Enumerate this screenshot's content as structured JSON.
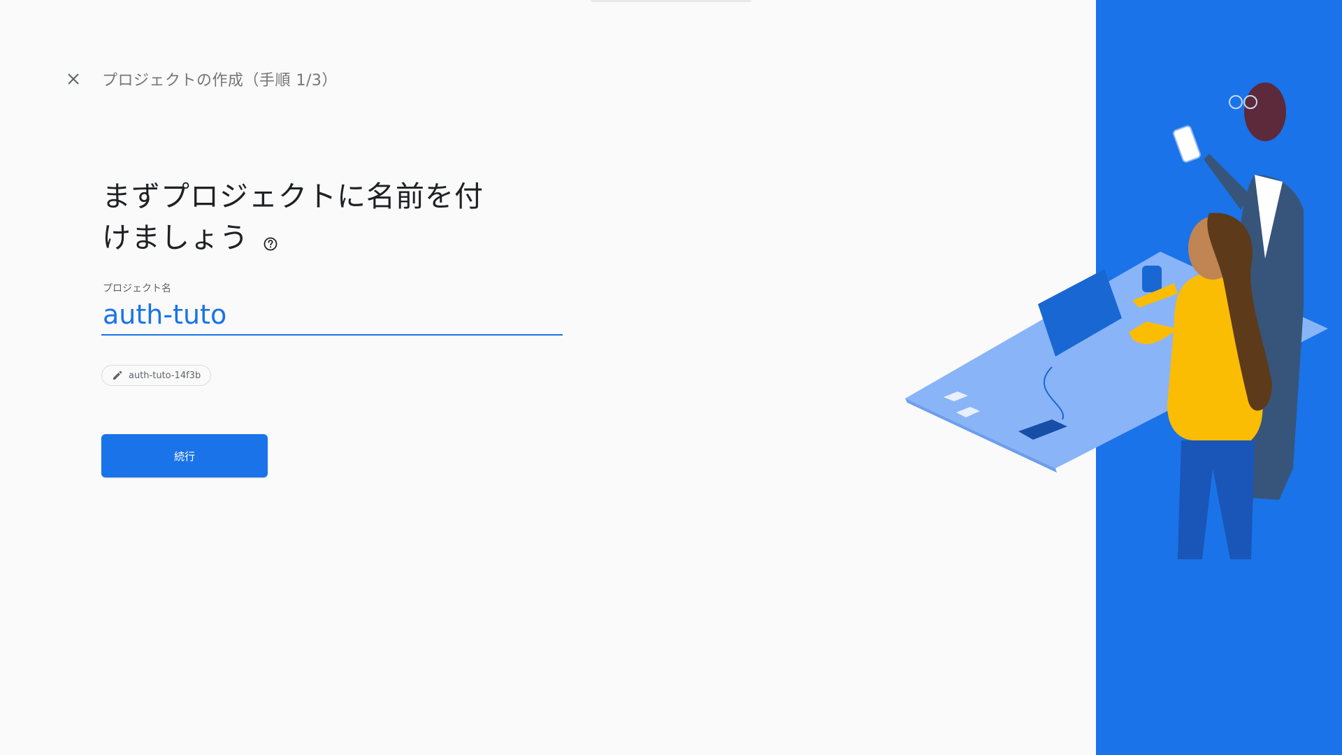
{
  "header": {
    "close_icon": "close-icon",
    "title": "プロジェクトの作成（手順 1/3）"
  },
  "main": {
    "headline_line1": "まずプロジェクトに名前を付",
    "headline_line2": "けましょう",
    "help_icon": "help-circle-icon",
    "project_name_label": "プロジェクト名",
    "project_name_value": "auth-tuto",
    "project_id_chip": "auth-tuto-14f3b",
    "edit_icon": "pencil-icon",
    "continue_label": "続行"
  },
  "colors": {
    "accent": "#1a73e8",
    "panel": "#1a73e8",
    "background": "#fafafa",
    "text": "#202124"
  }
}
